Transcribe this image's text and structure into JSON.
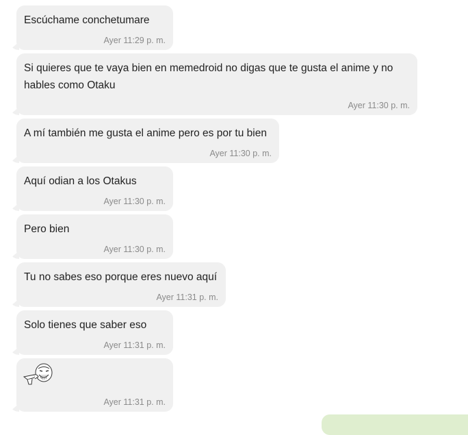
{
  "messages": [
    {
      "text": "Escúchame conchetumare",
      "time": "Ayer 11:29 p. m."
    },
    {
      "text": "Si quieres que te vaya bien en memedroid no digas que te gusta el anime y no hables como Otaku",
      "time": "Ayer 11:30 p. m."
    },
    {
      "text": "A mí también me gusta el anime pero es por tu bien",
      "time": "Ayer 11:30 p. m."
    },
    {
      "text": "Aquí odian a los Otakus",
      "time": "Ayer 11:30 p. m."
    },
    {
      "text": "Pero bien",
      "time": "Ayer 11:30 p. m."
    },
    {
      "text": "Tu no sabes eso porque eres nuevo aquí",
      "time": "Ayer 11:31 p. m."
    },
    {
      "text": "Solo tienes que saber eso",
      "time": "Ayer 11:31 p. m."
    },
    {
      "sticker": "rage-face-pointing-sticker",
      "time": "Ayer 11:31 p. m."
    }
  ],
  "colors": {
    "incoming_bubble": "#f0f0f0",
    "outgoing_bubble": "#dfeecf",
    "text": "#222222",
    "timestamp": "#8a8a8a"
  }
}
